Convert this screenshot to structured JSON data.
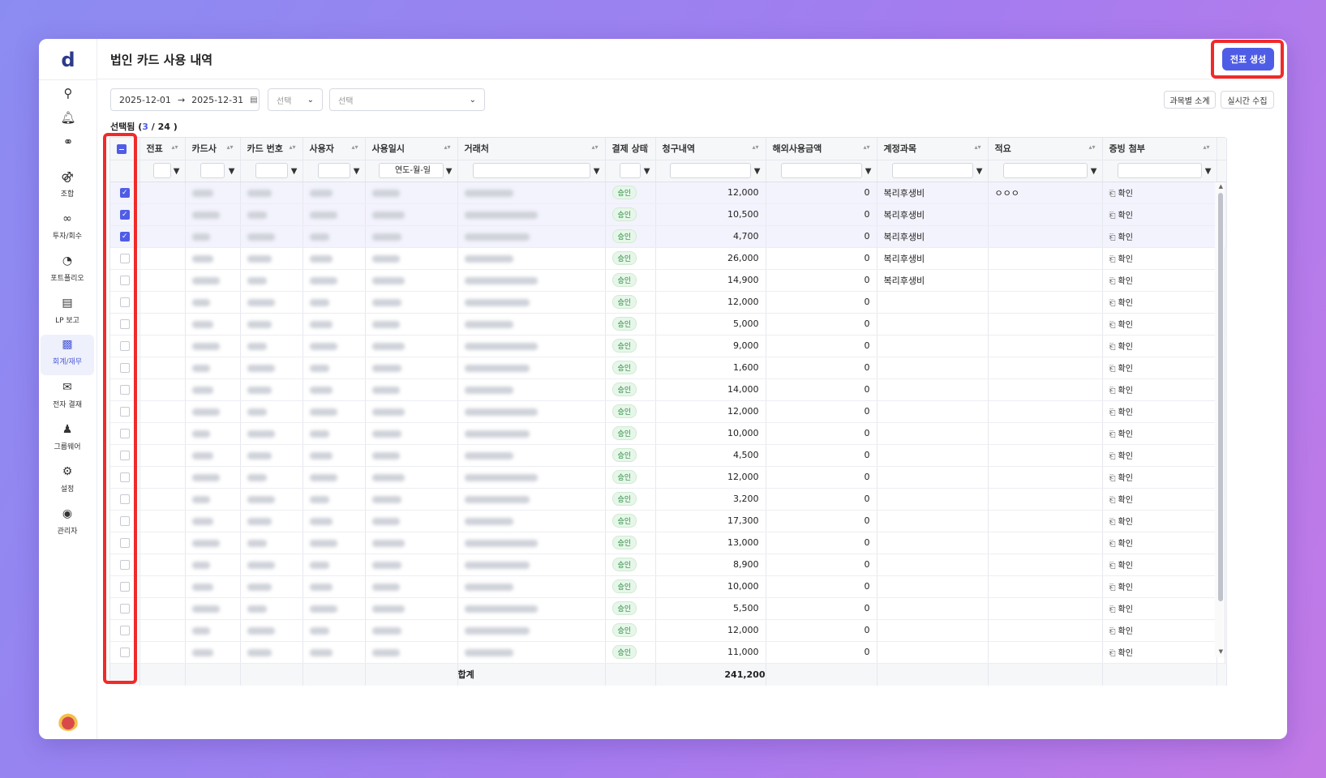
{
  "app": {
    "logo": "d"
  },
  "sidebar": {
    "utility_icons": [
      "search-icon",
      "bell-icon",
      "headset-icon"
    ],
    "items": [
      {
        "label": "조합",
        "icon": "union-icon"
      },
      {
        "label": "투자/회수",
        "icon": "invest-icon"
      },
      {
        "label": "포트폴리오",
        "icon": "pie-chart-icon"
      },
      {
        "label": "LP 보고",
        "icon": "report-icon"
      },
      {
        "label": "회계/재무",
        "icon": "finance-icon",
        "active": true
      },
      {
        "label": "전자 결재",
        "icon": "mail-icon"
      },
      {
        "label": "그룹웨어",
        "icon": "users-icon"
      },
      {
        "label": "설정",
        "icon": "gear-icon"
      },
      {
        "label": "관리자",
        "icon": "admin-icon"
      }
    ]
  },
  "header": {
    "title": "법인 카드 사용 내역",
    "create_button": "전표 생성"
  },
  "filters": {
    "date_from": "2025-12-01",
    "date_to": "2025-12-31",
    "select1_placeholder": "선택",
    "select2_placeholder": "선택",
    "btn_subtotal": "과목별 소계",
    "btn_realtime": "실시간 수집"
  },
  "selection": {
    "prefix": "선택됨 (",
    "selected": "3",
    "separator": " / ",
    "total": "24",
    "suffix": " )"
  },
  "table": {
    "columns": [
      "전표",
      "카드사",
      "카드 번호",
      "사용자",
      "사용일시",
      "거래처",
      "결제 상태",
      "청구내역",
      "해외사용금액",
      "계정과목",
      "적요",
      "증빙 첨부"
    ],
    "date_filter_placeholder": "연도-월-일",
    "status_label": "승인",
    "attach_label": "확인",
    "rows": [
      {
        "checked": true,
        "amount": "12,000",
        "foreign": "0",
        "account": "복리후생비",
        "memo": "ㅇㅇㅇ"
      },
      {
        "checked": true,
        "amount": "10,500",
        "foreign": "0",
        "account": "복리후생비",
        "memo": ""
      },
      {
        "checked": true,
        "amount": "4,700",
        "foreign": "0",
        "account": "복리후생비",
        "memo": ""
      },
      {
        "checked": false,
        "amount": "26,000",
        "foreign": "0",
        "account": "복리후생비",
        "memo": ""
      },
      {
        "checked": false,
        "amount": "14,900",
        "foreign": "0",
        "account": "복리후생비",
        "memo": ""
      },
      {
        "checked": false,
        "amount": "12,000",
        "foreign": "0",
        "account": "",
        "memo": ""
      },
      {
        "checked": false,
        "amount": "5,000",
        "foreign": "0",
        "account": "",
        "memo": ""
      },
      {
        "checked": false,
        "amount": "9,000",
        "foreign": "0",
        "account": "",
        "memo": ""
      },
      {
        "checked": false,
        "amount": "1,600",
        "foreign": "0",
        "account": "",
        "memo": ""
      },
      {
        "checked": false,
        "amount": "14,000",
        "foreign": "0",
        "account": "",
        "memo": ""
      },
      {
        "checked": false,
        "amount": "12,000",
        "foreign": "0",
        "account": "",
        "memo": ""
      },
      {
        "checked": false,
        "amount": "10,000",
        "foreign": "0",
        "account": "",
        "memo": ""
      },
      {
        "checked": false,
        "amount": "4,500",
        "foreign": "0",
        "account": "",
        "memo": ""
      },
      {
        "checked": false,
        "amount": "12,000",
        "foreign": "0",
        "account": "",
        "memo": ""
      },
      {
        "checked": false,
        "amount": "3,200",
        "foreign": "0",
        "account": "",
        "memo": ""
      },
      {
        "checked": false,
        "amount": "17,300",
        "foreign": "0",
        "account": "",
        "memo": ""
      },
      {
        "checked": false,
        "amount": "13,000",
        "foreign": "0",
        "account": "",
        "memo": ""
      },
      {
        "checked": false,
        "amount": "8,900",
        "foreign": "0",
        "account": "",
        "memo": ""
      },
      {
        "checked": false,
        "amount": "10,000",
        "foreign": "0",
        "account": "",
        "memo": ""
      },
      {
        "checked": false,
        "amount": "5,500",
        "foreign": "0",
        "account": "",
        "memo": ""
      },
      {
        "checked": false,
        "amount": "12,000",
        "foreign": "0",
        "account": "",
        "memo": ""
      },
      {
        "checked": false,
        "amount": "11,000",
        "foreign": "0",
        "account": "",
        "memo": ""
      }
    ],
    "footer": {
      "label": "합계",
      "total": "241,200"
    }
  },
  "colors": {
    "accent": "#4f5de6",
    "highlight": "#f02a2a",
    "status_bg": "#e7f6ea",
    "status_text": "#2a8a3f"
  }
}
